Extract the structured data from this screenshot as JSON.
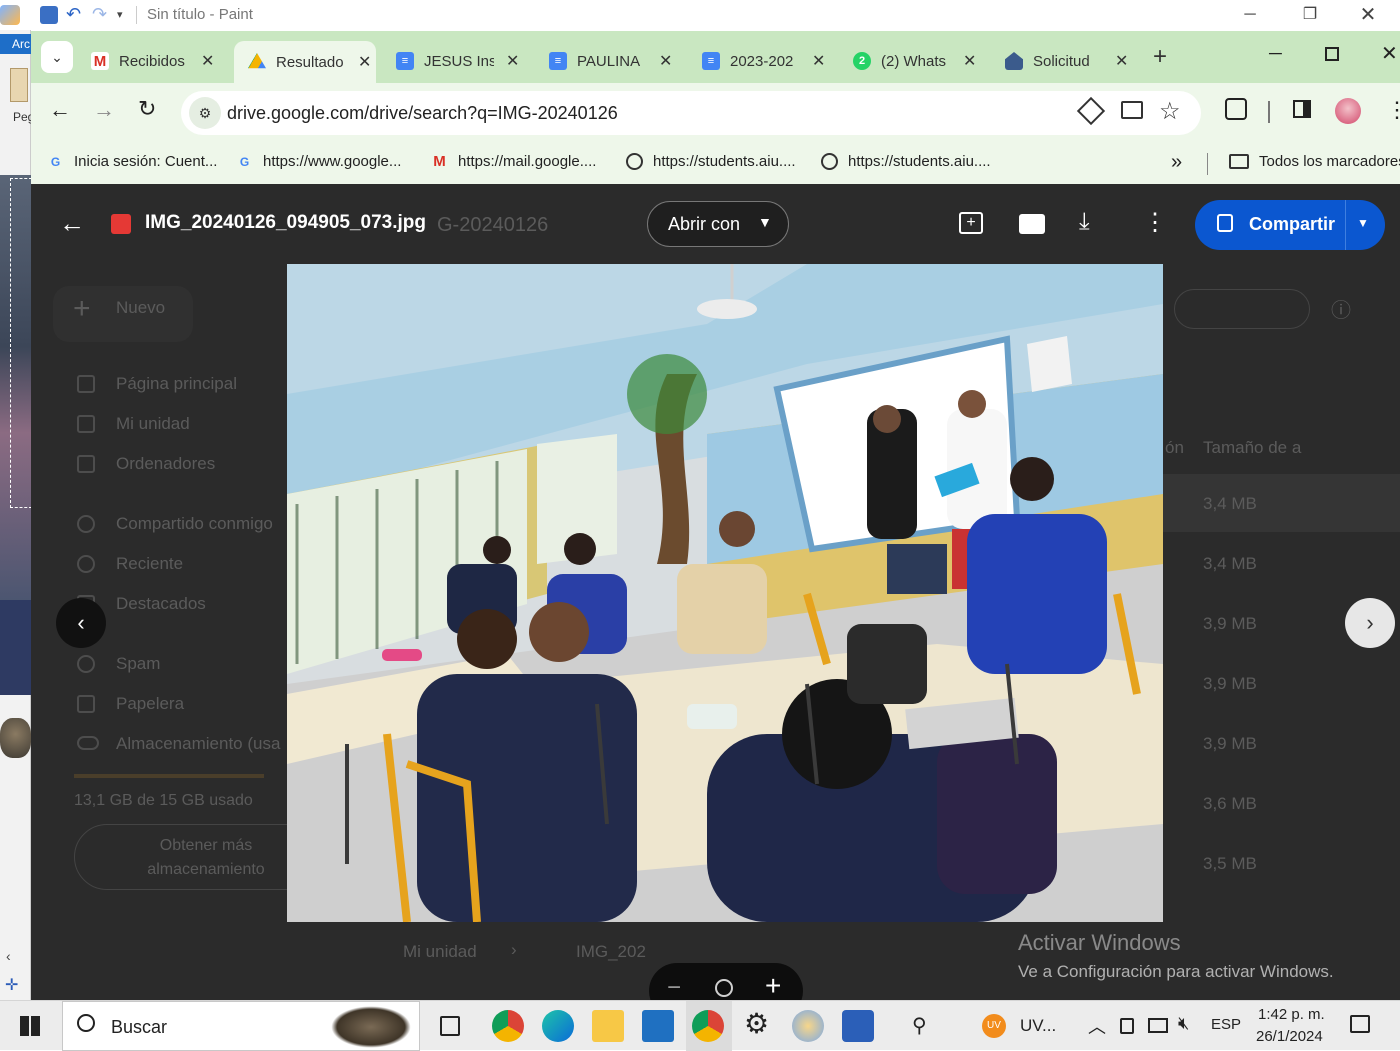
{
  "paint": {
    "title": "Sin título - Paint",
    "ribbon_tab": "Arc",
    "paste_label": "Peg"
  },
  "chrome": {
    "tabs": [
      {
        "label": "Recibidos",
        "icon": "gmail-icon",
        "color": "#d93025"
      },
      {
        "label": "Resultado",
        "icon": "google-drive-icon",
        "color": "#1fa463",
        "active": true
      },
      {
        "label": "JESUS Ins",
        "icon": "google-docs-icon",
        "color": "#4285f4"
      },
      {
        "label": "PAULINA",
        "icon": "google-docs-icon",
        "color": "#4285f4"
      },
      {
        "label": "2023-202",
        "icon": "google-docs-icon",
        "color": "#4285f4"
      },
      {
        "label": "(2) Whats",
        "icon": "whatsapp-icon",
        "color": "#25d366",
        "badge": "2"
      },
      {
        "label": "Solicitud",
        "icon": "institution-icon",
        "color": "#3b5b8c"
      }
    ],
    "new_tab": "+",
    "url": "drive.google.com/drive/search?q=IMG-20240126",
    "bookmarks": [
      {
        "label": "Inicia sesión: Cuent...",
        "icon": "google-icon"
      },
      {
        "label": "https://www.google...",
        "icon": "google-icon"
      },
      {
        "label": "https://mail.google....",
        "icon": "gmail-icon"
      },
      {
        "label": "https://students.aiu....",
        "icon": "globe-icon"
      },
      {
        "label": "https://students.aiu....",
        "icon": "globe-icon"
      }
    ],
    "bookmarks_more": "»",
    "all_bookmarks": "Todos los marcadores"
  },
  "viewer": {
    "filename": "IMG_20240126_094905_073.jpg",
    "open_with": "Abrir con",
    "share": "Compartir",
    "zoom_out": "−",
    "zoom_in": "+"
  },
  "drive_bg": {
    "search_ghost": "G-20240126",
    "new_button": "Nuevo",
    "nav": [
      "Página principal",
      "Mi unidad",
      "Ordenadores",
      "Compartido conmigo",
      "Reciente",
      "Destacados",
      "Spam",
      "Papelera",
      "Almacenamiento (usa"
    ],
    "storage_text": "13,1 GB de 15 GB usado",
    "get_more": "Obtener más almacenamiento",
    "col_header_partial": "ón",
    "col_header": "Tamaño de a",
    "sizes": [
      "3,4 MB",
      "3,4 MB",
      "3,9 MB",
      "3,9 MB",
      "3,9 MB",
      "3,6 MB",
      "3,5 MB"
    ],
    "breadcrumb": [
      "Mi unidad",
      "IMG_202"
    ]
  },
  "watermark": {
    "title": "Activar Windows",
    "subtitle": "Ve a Configuración para activar Windows."
  },
  "taskbar": {
    "search_placeholder": "Buscar",
    "tray_app": "UV...",
    "lang": "ESP",
    "time": "1:42 p. m.",
    "date": "26/1/2024"
  }
}
